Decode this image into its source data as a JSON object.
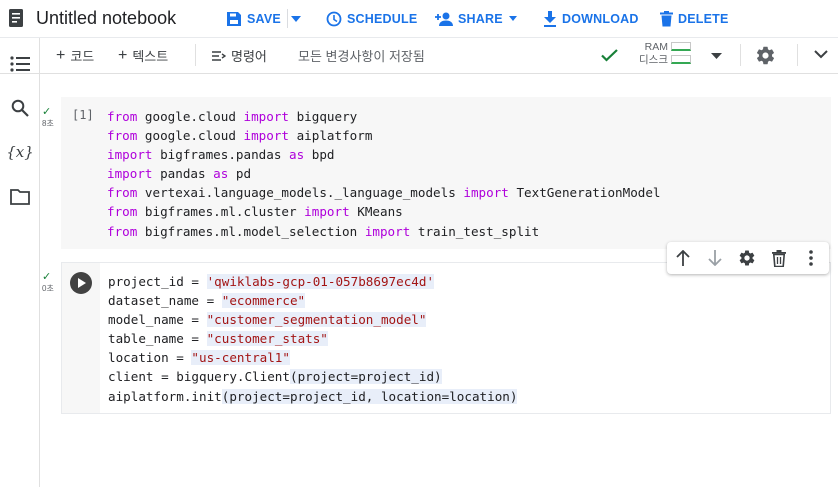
{
  "header": {
    "title": "Untitled notebook",
    "save_label": "SAVE",
    "schedule_label": "SCHEDULE",
    "share_label": "SHARE",
    "download_label": "DOWNLOAD",
    "delete_label": "DELETE"
  },
  "toolbar": {
    "add_code_label": "코드",
    "add_text_label": "텍스트",
    "command_label": "명령어",
    "saved_status": "모든 변경사항이 저장됨",
    "ram_label": "RAM",
    "disk_label": "디스크"
  },
  "sidebar": {
    "items": [
      {
        "icon": "toc-icon"
      },
      {
        "icon": "search-icon"
      },
      {
        "icon": "variables-icon",
        "label": "{x}"
      },
      {
        "icon": "folder-icon"
      }
    ]
  },
  "cells": [
    {
      "execution_count": "[1]",
      "status_time": "8초",
      "lines": [
        "from google.cloud import bigquery",
        "from google.cloud import aiplatform",
        "import bigframes.pandas as bpd",
        "import pandas as pd",
        "from vertexai.language_models._language_models import TextGenerationModel",
        "from bigframes.ml.cluster import KMeans",
        "from bigframes.ml.model_selection import train_test_split"
      ]
    },
    {
      "status_time": "0초",
      "lines": [
        "project_id = 'qwiklabs-gcp-01-057b8697ec4d'",
        "dataset_name = \"ecommerce\"",
        "model_name = \"customer_segmentation_model\"",
        "table_name = \"customer_stats\"",
        "location = \"us-central1\"",
        "client = bigquery.Client(project=project_id)",
        "aiplatform.init(project=project_id, location=location)"
      ]
    }
  ],
  "colors": {
    "accent": "#1a73e8",
    "keyword": "#af00db",
    "string": "#a31515",
    "success": "#188038"
  }
}
